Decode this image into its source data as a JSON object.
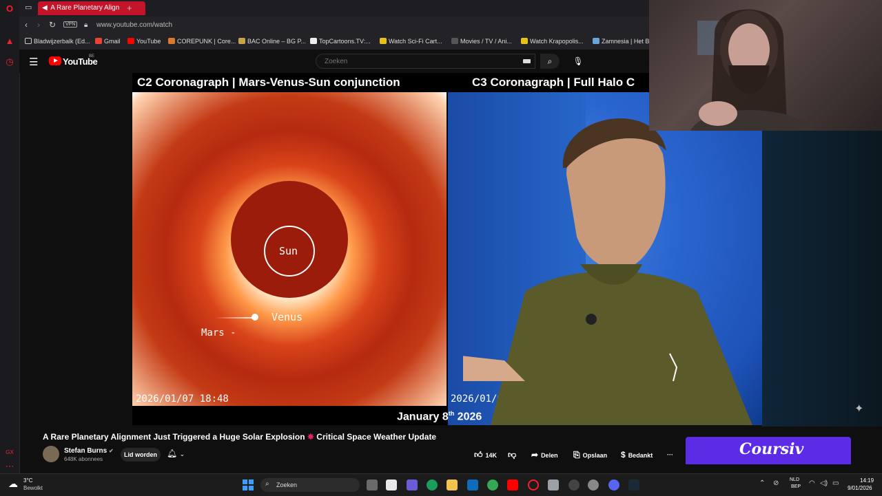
{
  "browser": {
    "tab_title": "A Rare Planetary Align",
    "url": "www.youtube.com/watch",
    "vpn_label": "VPN",
    "bookmarks": [
      {
        "label": "Bladwijzerbalk (Ed..."
      },
      {
        "label": "Gmail"
      },
      {
        "label": "YouTube"
      },
      {
        "label": "COREPUNK | Core..."
      },
      {
        "label": "BAC Online – BG P..."
      },
      {
        "label": "TopCartoons.TV:..."
      },
      {
        "label": "Watch Sci-Fi Cart..."
      },
      {
        "label": "Movies / TV / Ani..."
      },
      {
        "label": "Watch Krapopolis..."
      },
      {
        "label": "Zamnesia | Het Be"
      }
    ]
  },
  "youtube": {
    "logo_text": "YouTube",
    "region": "BE",
    "search_placeholder": "Zoeken"
  },
  "video_frame": {
    "title_left": "C2 Coronagraph  |  Mars-Venus-Sun conjunction",
    "title_right": "C3 Coronagraph  |  Full Halo C",
    "sun_label": "Sun",
    "venus_label": "Venus",
    "mars_label": "Mars -",
    "timestamp_left": "2026/01/07 18:48",
    "timestamp_right": "2026/01/0",
    "date_caption_main": "January 8",
    "date_caption_sup": "th",
    "date_caption_year": " 2026"
  },
  "video_info": {
    "title_part1": "A Rare Planetary Alignment Just Triggered a Huge Solar Explosion ",
    "title_spark": "✸",
    "title_part2": " Critical Space Weather Update",
    "channel_name": "Stefan Burns",
    "subscribers": "648K abonnees",
    "join_label": "Lid worden",
    "like_count": "14K",
    "share_label": "Delen",
    "save_label": "Opslaan",
    "thanks_label": "Bedankt",
    "more_label": "···"
  },
  "ad": {
    "brand": "Coursiv"
  },
  "taskbar": {
    "temperature": "3°C",
    "condition": "Bewolkt",
    "search_label": "Zoeken",
    "lang_line1": "NLD",
    "lang_line2": "BEP",
    "time": "14:19",
    "date": "9/01/2026"
  },
  "colors": {
    "youtube_red": "#ff0000",
    "opera_red": "#c4142a",
    "ad_purple": "#5b2be6"
  }
}
